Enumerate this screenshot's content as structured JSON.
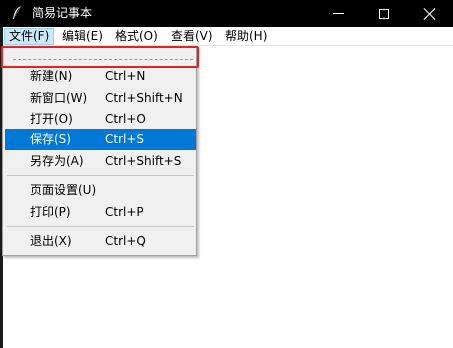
{
  "window": {
    "title": "简易记事本",
    "icon": "feather-pen-icon"
  },
  "menubar": {
    "items": [
      {
        "label": "文件(F)",
        "active": true
      },
      {
        "label": "编辑(E)",
        "active": false
      },
      {
        "label": "格式(O)",
        "active": false
      },
      {
        "label": "查看(V)",
        "active": false
      },
      {
        "label": "帮助(H)",
        "active": false
      }
    ]
  },
  "file_menu": {
    "items": [
      {
        "label": "新建(N)",
        "shortcut": "Ctrl+N",
        "selected": false
      },
      {
        "label": "新窗口(W)",
        "shortcut": "Ctrl+Shift+N",
        "selected": false
      },
      {
        "label": "打开(O)",
        "shortcut": "Ctrl+O",
        "selected": false
      },
      {
        "label": "保存(S)",
        "shortcut": "Ctrl+S",
        "selected": true
      },
      {
        "label": "另存为(A)",
        "shortcut": "Ctrl+Shift+S",
        "selected": false
      },
      {
        "label": "页面设置(U)",
        "shortcut": "",
        "selected": false
      },
      {
        "label": "打印(P)",
        "shortcut": "Ctrl+P",
        "selected": false
      },
      {
        "label": "退出(X)",
        "shortcut": "Ctrl+Q",
        "selected": false
      }
    ]
  },
  "colors": {
    "selection": "#0078d7",
    "highlight_outline": "#e8211b",
    "active_menu_bg": "#cce8ff"
  }
}
